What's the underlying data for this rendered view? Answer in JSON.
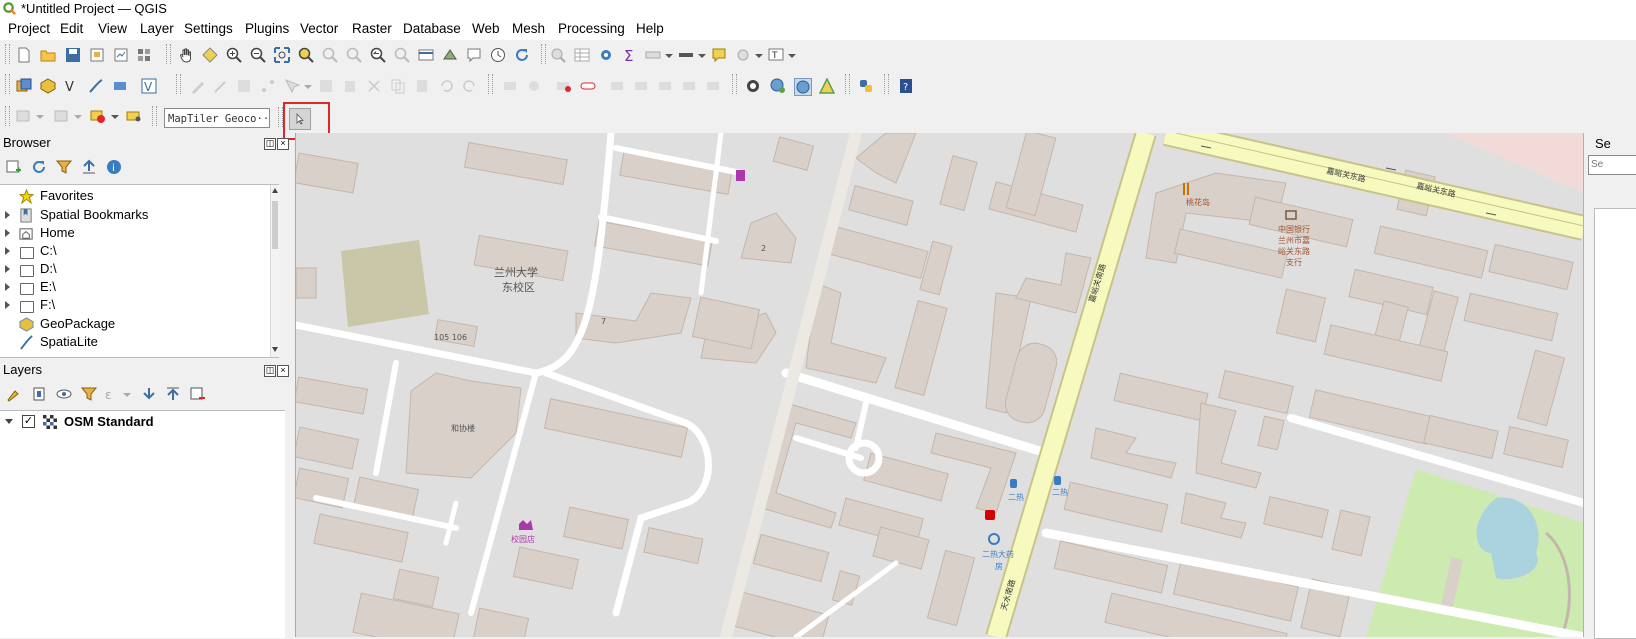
{
  "window": {
    "title": "*Untitled Project — QGIS"
  },
  "menu": [
    "Project",
    "Edit",
    "View",
    "Layer",
    "Settings",
    "Plugins",
    "Vector",
    "Raster",
    "Database",
    "Web",
    "Mesh",
    "Processing",
    "Help"
  ],
  "geocoder": {
    "placeholder": "MapTiler Geoco···"
  },
  "browser": {
    "title": "Browser",
    "items": [
      "Favorites",
      "Spatial Bookmarks",
      "Home",
      "C:\\",
      "D:\\",
      "E:\\",
      "F:\\",
      "GeoPackage",
      "SpatiaLite"
    ]
  },
  "layers": {
    "title": "Layers",
    "items": [
      {
        "name": "OSM Standard",
        "checked": true
      }
    ]
  },
  "right_panel": {
    "title": "Se",
    "input_placeholder": "Se"
  },
  "map": {
    "labels": {
      "campus": "兰州大学\n东校区",
      "campus_line1": "兰州大学",
      "campus_line2": "东校区",
      "building_105": "105 106",
      "building_2": "2",
      "building_7": "7",
      "hexie": "和协楼",
      "shop": "校园店",
      "road_jiayuguan_1": "嘉峪关东路",
      "road_jiayuguan_2": "嘉峪关东路",
      "road_vertical": "嘉峪关南路",
      "road_vertical_2": "天水南路",
      "tao": "桃花岛",
      "bank_1": "中国银行",
      "bank_2": "兰州市嘉",
      "bank_3": "峪关东路",
      "bank_4": "支行",
      "bus_1": "二热",
      "bus_2": "二热",
      "bike_1": "二热大药",
      "bike_2": "房"
    },
    "colors": {
      "background": "#e0dfdf",
      "building": "#d9d0c9",
      "building_outline": "#c4b6ab",
      "park": "#cdebb0",
      "grass": "#c9c7a8",
      "major_road": "#f7fabf",
      "water": "#aad3df",
      "label": "#555555",
      "poi": "#a0522d",
      "accent_purple": "#ac39ac"
    }
  }
}
